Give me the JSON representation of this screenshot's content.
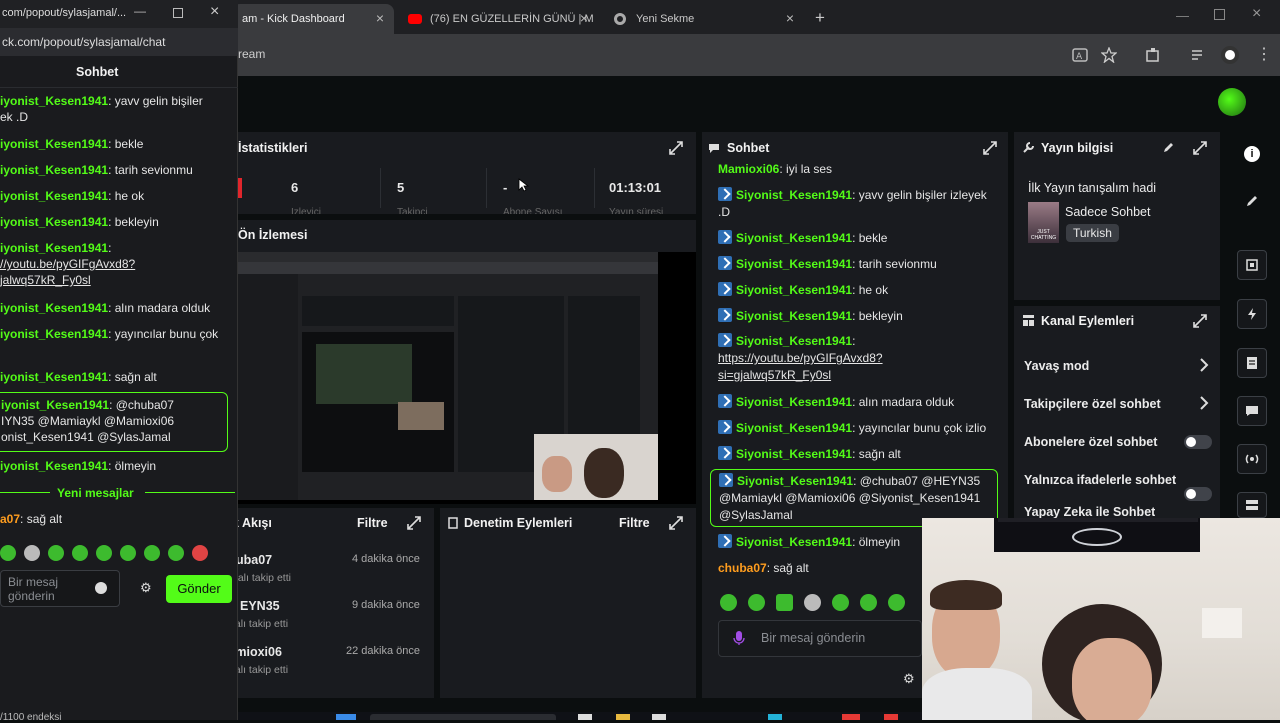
{
  "browser": {
    "tabs": [
      {
        "label": "am - Kick Dashboard",
        "active": true
      },
      {
        "label": "(76) EN GÜZELLERİN GÜNÜ | M",
        "active": false
      },
      {
        "label": "Yeni Sekme",
        "active": false
      }
    ],
    "url": "ream"
  },
  "popout": {
    "url": "ck.com/popout/sylasjamal/chat",
    "window_title": "com/popout/sylasjamal/...",
    "title": "Sohbet",
    "messages": [
      {
        "user": "iyonist_Kesen1941",
        "text": "yavv gelin bişiler",
        "text2": "ek .D"
      },
      {
        "user": "iyonist_Kesen1941",
        "text": "bekle"
      },
      {
        "user": "iyonist_Kesen1941",
        "text": "tarih sevionmu"
      },
      {
        "user": "iyonist_Kesen1941",
        "text": "he ok"
      },
      {
        "user": "iyonist_Kesen1941",
        "text": "bekleyin"
      },
      {
        "user": "iyonist_Kesen1941",
        "text": ":",
        "link1": "//youtu.be/pyGIFgAvxd8?",
        "link2": "jalwq57kR_Fy0sl"
      },
      {
        "user": "iyonist_Kesen1941",
        "text": "alın madara olduk"
      },
      {
        "user": "iyonist_Kesen1941",
        "text": "yayıncılar bunu çok"
      },
      {
        "user": "iyonist_Kesen1941",
        "text": "sağn alt"
      },
      {
        "user": "iyonist_Kesen1941",
        "text": "@chuba07",
        "text2": "IYN35 @Mamiaykl @Mamioxi06",
        "text3": "onist_Kesen1941 @SylasJamal"
      },
      {
        "user": "iyonist_Kesen1941",
        "text": "ölmeyin"
      }
    ],
    "new_messages": "Yeni mesajlar",
    "last_msg": {
      "user": "a07",
      "text": "sağ alt"
    },
    "input_placeholder_1": "Bir mesaj",
    "input_placeholder_2": "gönderin",
    "send": "Gönder",
    "footer": "/1100 endeksi"
  },
  "stats": {
    "title": "İstatistikleri",
    "values": [
      "6",
      "5",
      "-",
      "01:13:01"
    ],
    "labels": [
      "İzleyici",
      "Takipçi",
      "Abone Sayısı",
      "Yayın süresi"
    ]
  },
  "preview": {
    "title": "Ön İzlemesi"
  },
  "activity": {
    "title": "k Akışı",
    "filter": "Filtre",
    "items": [
      {
        "user": "uba07",
        "action": "nalı takip etti",
        "time": "4 dakika önce"
      },
      {
        "user": "EYN35",
        "action": "kanalı takip etti",
        "time": "9 dakika önce"
      },
      {
        "user": "Mamioxi06",
        "action": "kanalı takip etti",
        "time": "22 dakika önce"
      }
    ]
  },
  "moderation": {
    "title": "Denetim Eylemleri",
    "filter": "Filtre"
  },
  "chat": {
    "title": "Sohbet",
    "messages": [
      {
        "user": "Mamioxi06",
        "text": "iyi la ses",
        "badge": false
      },
      {
        "user": "Siyonist_Kesen1941",
        "text": "yavv gelin bişiler izleyek",
        "text2": ".D",
        "badge": true
      },
      {
        "user": "Siyonist_Kesen1941",
        "text": "bekle",
        "badge": true
      },
      {
        "user": "Siyonist_Kesen1941",
        "text": "tarih sevionmu",
        "badge": true
      },
      {
        "user": "Siyonist_Kesen1941",
        "text": "he ok",
        "badge": true
      },
      {
        "user": "Siyonist_Kesen1941",
        "text": "bekleyin",
        "badge": true
      },
      {
        "user": "Siyonist_Kesen1941",
        "text": ":",
        "link1": "https://youtu.be/pyGIFgAvxd8?",
        "link2": "si=gjalwq57kR_Fy0sl",
        "badge": true
      },
      {
        "user": "Siyonist_Kesen1941",
        "text": "alın madara olduk",
        "badge": true
      },
      {
        "user": "Siyonist_Kesen1941",
        "text": "yayıncılar bunu çok izlio",
        "badge": true
      },
      {
        "user": "Siyonist_Kesen1941",
        "text": "sağn alt",
        "badge": true
      },
      {
        "user": "Siyonist_Kesen1941",
        "text": "@chuba07 @HEYN35",
        "text2": "@Mamiaykl @Mamioxi06 @Siyonist_Kesen1941",
        "text3": "@SylasJamal",
        "badge": true
      },
      {
        "user": "Siyonist_Kesen1941",
        "text": "ölmeyin",
        "badge": true
      },
      {
        "user": "chuba07",
        "text": "sağ alt",
        "badge": false
      }
    ],
    "input_placeholder": "Bir mesaj gönderin"
  },
  "stream_info": {
    "title": "Yayın bilgisi",
    "stream_title": "İlk Yayın tanışalım hadi",
    "category": "Sadece Sohbet",
    "language": "Turkish",
    "thumb_label": "JUST CHATTING"
  },
  "channel_actions": {
    "title": "Kanal Eylemleri",
    "items": [
      {
        "label": "Yavaş mod",
        "kind": "arrow"
      },
      {
        "label": "Takipçilere özel sohbet",
        "kind": "arrow"
      },
      {
        "label": "Abonelere özel sohbet",
        "kind": "toggle"
      },
      {
        "label": "Yalnızca ifadelerle sohbet",
        "kind": "toggle"
      },
      {
        "label": "Yapay Zeka ile Sohbet",
        "kind": "none"
      }
    ]
  },
  "colors": {
    "accent": "#53fc18",
    "panel": "#191b1f",
    "background": "#0b0e0f"
  }
}
